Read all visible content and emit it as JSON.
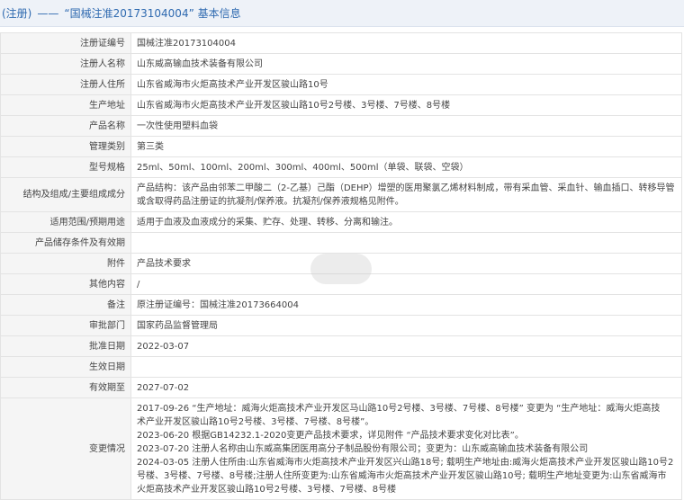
{
  "header": {
    "prefix": "(注册)",
    "dash": "——",
    "title": "“国械注准20173104004” 基本信息"
  },
  "rows": [
    {
      "label": "注册证编号",
      "value": "国械注准20173104004"
    },
    {
      "label": "注册人名称",
      "value": "山东威高输血技术装备有限公司"
    },
    {
      "label": "注册人住所",
      "value": "山东省威海市火炬高技术产业开发区骏山路10号"
    },
    {
      "label": "生产地址",
      "value": "山东省威海市火炬高技术产业开发区骏山路10号2号楼、3号楼、7号楼、8号楼"
    },
    {
      "label": "产品名称",
      "value": "一次性使用塑料血袋"
    },
    {
      "label": "管理类别",
      "value": "第三类"
    },
    {
      "label": "型号规格",
      "value": "25ml、50ml、100ml、200ml、300ml、400ml、500ml（单袋、联袋、空袋）"
    },
    {
      "label": "结构及组成/主要组成成分",
      "value": "产品结构：该产品由邻苯二甲酸二（2-乙基）己酯（DEHP）增塑的医用聚氯乙烯材料制成，带有采血管、采血针、输血插口、转移导管或含取得药品注册证的抗凝剂/保养液。抗凝剂/保养液规格见附件。"
    },
    {
      "label": "适用范围/预期用途",
      "value": "适用于血液及血液成分的采集、贮存、处理、转移、分离和输注。"
    },
    {
      "label": "产品储存条件及有效期",
      "value": ""
    },
    {
      "label": "附件",
      "value": "产品技术要求"
    },
    {
      "label": "其他内容",
      "value": "/"
    },
    {
      "label": "备注",
      "value": "原注册证编号：国械注准20173664004"
    },
    {
      "label": "审批部门",
      "value": "国家药品监督管理局"
    },
    {
      "label": "批准日期",
      "value": "2022-03-07"
    },
    {
      "label": "生效日期",
      "value": ""
    },
    {
      "label": "有效期至",
      "value": "2027-07-02"
    }
  ],
  "changes": {
    "label": "变更情况",
    "lines": [
      "2017-09-26 “生产地址：威海火炬高技术产业开发区马山路10号2号楼、3号楼、7号楼、8号楼” 变更为 “生产地址：威海火炬高技",
      "术产业开发区骏山路10号2号楼、3号楼、7号楼、8号楼”。",
      "2023-06-20 根据GB14232.1-2020变更产品技术要求，详见附件 “产品技术要求变化对比表”。",
      "2023-07-20 注册人名称由山东威高集团医用高分子制品股份有限公司；变更为：山东威高输血技术装备有限公司",
      "2024-03-05 注册人住所由:山东省威海市火炬高技术产业开发区兴山路18号; 载明生产地址由:威海火炬高技术产业开发区骏山路10号2",
      "号楼、3号楼、7号楼、8号楼;注册人住所变更为:山东省威海市火炬高技术产业开发区骏山路10号; 载明生产地址变更为:山东省威海市",
      "火炬高技术产业开发区骏山路10号2号楼、3号楼、7号楼、8号楼"
    ]
  }
}
